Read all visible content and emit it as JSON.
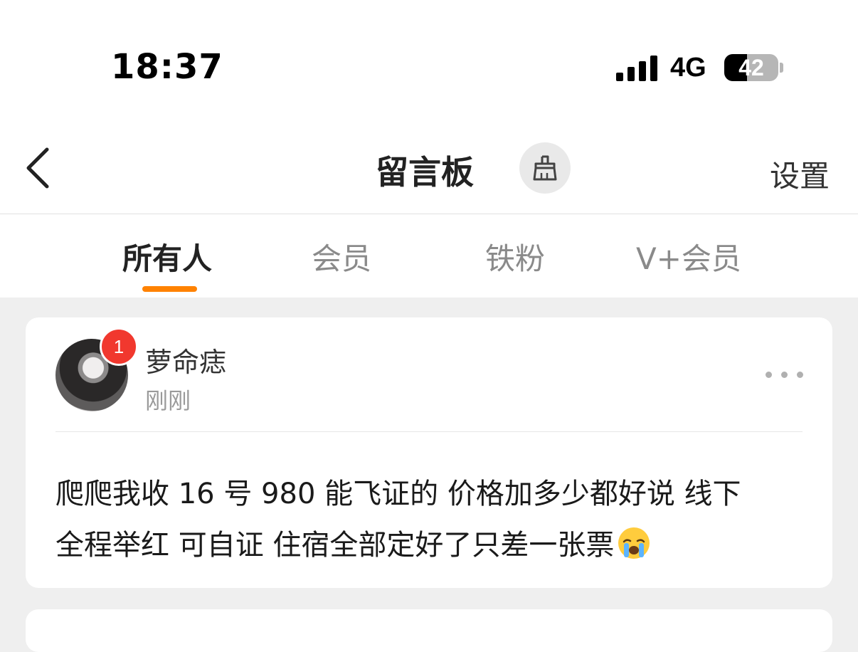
{
  "status_bar": {
    "time": "18:37",
    "network": "4G",
    "battery": "42",
    "battery_level": 0.42
  },
  "nav": {
    "title": "留言板",
    "settings_label": "设置"
  },
  "tabs": [
    {
      "label": "所有人",
      "active": true
    },
    {
      "label": "会员",
      "active": false
    },
    {
      "label": "铁粉",
      "active": false
    },
    {
      "label": "V+会员",
      "active": false
    }
  ],
  "post": {
    "badge_count": "1",
    "username": "萝命痣",
    "timestamp": "刚刚",
    "message_line1": "爬爬我收 16 号 980 能飞证的 价格加多少都好说 线下",
    "message_line2": "全程举红 可自证 住宿全部定好了只差一张票",
    "emoji": "crying-face"
  },
  "colors": {
    "accent": "#ff8200",
    "badge": "#f1382e",
    "background": "#efefef"
  }
}
